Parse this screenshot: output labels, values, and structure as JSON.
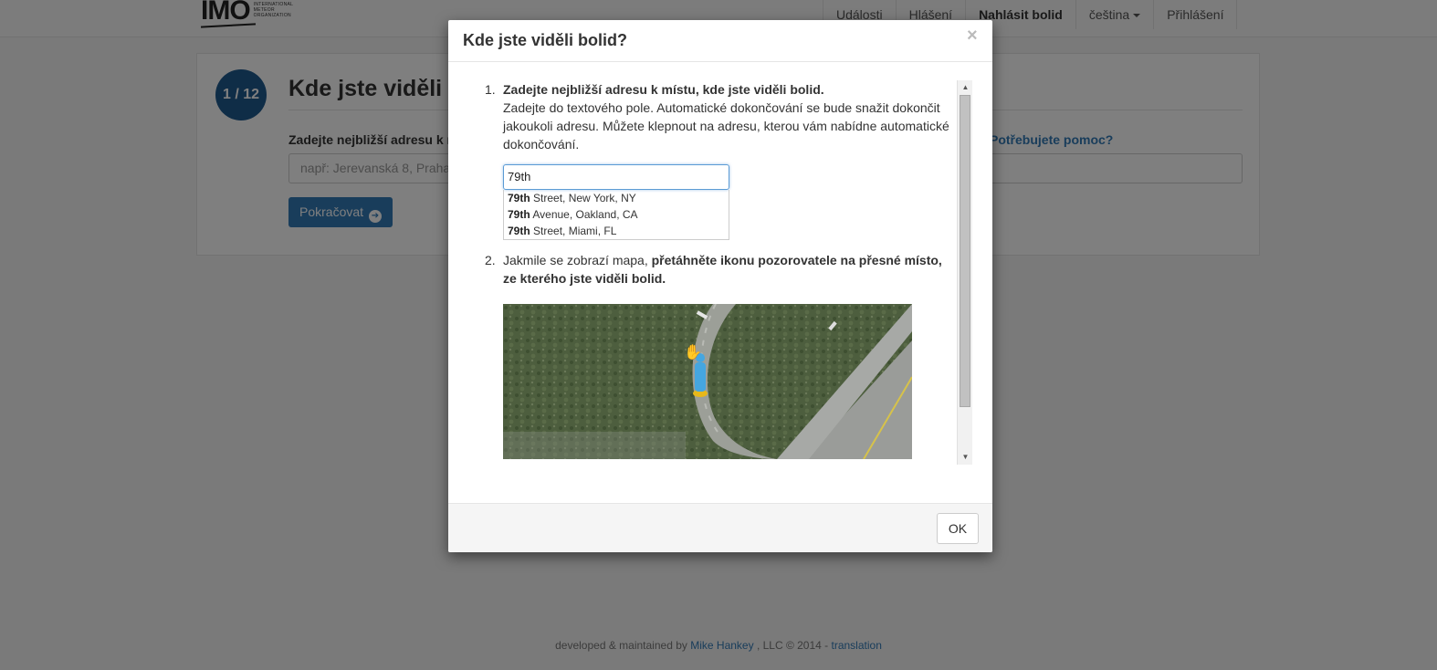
{
  "logo": {
    "text": "IMO",
    "sub": [
      "INTERNATIONAL",
      "METEOR",
      "ORGANIZATION"
    ]
  },
  "nav": {
    "items": [
      {
        "label": "Události"
      },
      {
        "label": "Hlášení"
      },
      {
        "label": "Nahlásit bolid"
      },
      {
        "label": "čeština"
      },
      {
        "label": "Přihlášení"
      }
    ]
  },
  "page": {
    "step": "1 / 12",
    "title": "Kde jste viděli bolid?",
    "field_label": "Zadejte nejbližší adresu k místu, kde jste viděli bolid.",
    "help_link": "Potřebujete pomoc?",
    "input_placeholder": "např: Jerevanská 8, Praha",
    "continue_label": "Pokračovat"
  },
  "footer": {
    "prefix": "developed & maintained by",
    "author": "Mike Hankey",
    "middle": ", LLC © 2014 -",
    "translation": "translation"
  },
  "modal": {
    "title": "Kde jste viděli bolid?",
    "close": "×",
    "steps": [
      {
        "num": "1.",
        "heading": "Zadejte nejbližší adresu k místu, kde jste viděli bolid.",
        "text": "Zadejte do textového pole. Automatické dokončování se bude snažit dokončit jakoukoli adresu. Můžete klepnout na adresu, kterou vám nabídne automatické dokončování."
      },
      {
        "num": "2.",
        "text_plain": "Jakmile se zobrazí mapa,",
        "text_bold": "přetáhněte ikonu pozorovatele na přesné místo, ze kterého jste viděli bolid."
      }
    ],
    "demo": {
      "input_value": "79th",
      "suggestions": [
        {
          "bold": "79th",
          "rest": " Street, New York, NY"
        },
        {
          "bold": "79th",
          "rest": " Avenue, Oakland, CA"
        },
        {
          "bold": "79th",
          "rest": " Street, Miami, FL"
        }
      ]
    },
    "ok_label": "OK"
  },
  "colors": {
    "accent": "#337ab7",
    "step_circle": "#1f5a8f"
  }
}
